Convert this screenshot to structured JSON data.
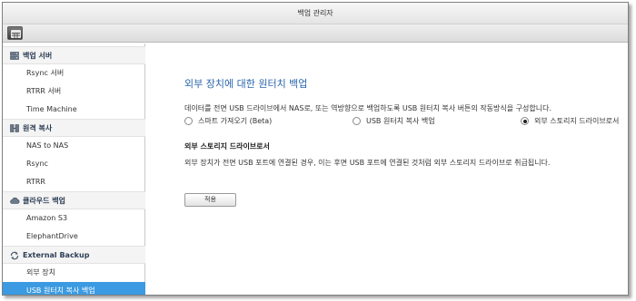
{
  "window": {
    "title": "백업 관리자"
  },
  "sidebar": {
    "groups": [
      {
        "label": "백업 서버",
        "icon": "backup-server-icon",
        "items": [
          {
            "label": "Rsync 서버"
          },
          {
            "label": "RTRR 서버"
          },
          {
            "label": "Time Machine"
          }
        ]
      },
      {
        "label": "원격 복사",
        "icon": "remote-copy-icon",
        "items": [
          {
            "label": "NAS to NAS"
          },
          {
            "label": "Rsync"
          },
          {
            "label": "RTRR"
          }
        ]
      },
      {
        "label": "클라우드 백업",
        "icon": "cloud-icon",
        "items": [
          {
            "label": "Amazon S3"
          },
          {
            "label": "ElephantDrive"
          }
        ]
      },
      {
        "label": "External Backup",
        "icon": "sync-icon",
        "items": [
          {
            "label": "외부 장치"
          },
          {
            "label": "USB 원터치 복사 백업",
            "selected": true
          }
        ]
      }
    ]
  },
  "main": {
    "title": "외부 장치에 대한 원터치 백업",
    "description": "데이터를 전면 USB 드라이브에서 NAS로, 또는 역방향으로 백업하도록 USB 원터치 복사 버튼의 작동방식을 구성합니다.",
    "options": [
      {
        "label": "스마트 가져오기 (Beta)",
        "selected": false
      },
      {
        "label": "USB 원터치 복사 백업",
        "selected": false
      },
      {
        "label": "외부 스토리지 드라이브로서",
        "selected": true
      }
    ],
    "section_title": "외부 스토리지 드라이브로서",
    "section_description": "외부 장치가 전면 USB 포트에 연결된 경우, 이는 후면 USB 포트에 연결된 것처럼 외부 스토리지 드라이브로 취급됩니다.",
    "apply_label": "적용"
  }
}
